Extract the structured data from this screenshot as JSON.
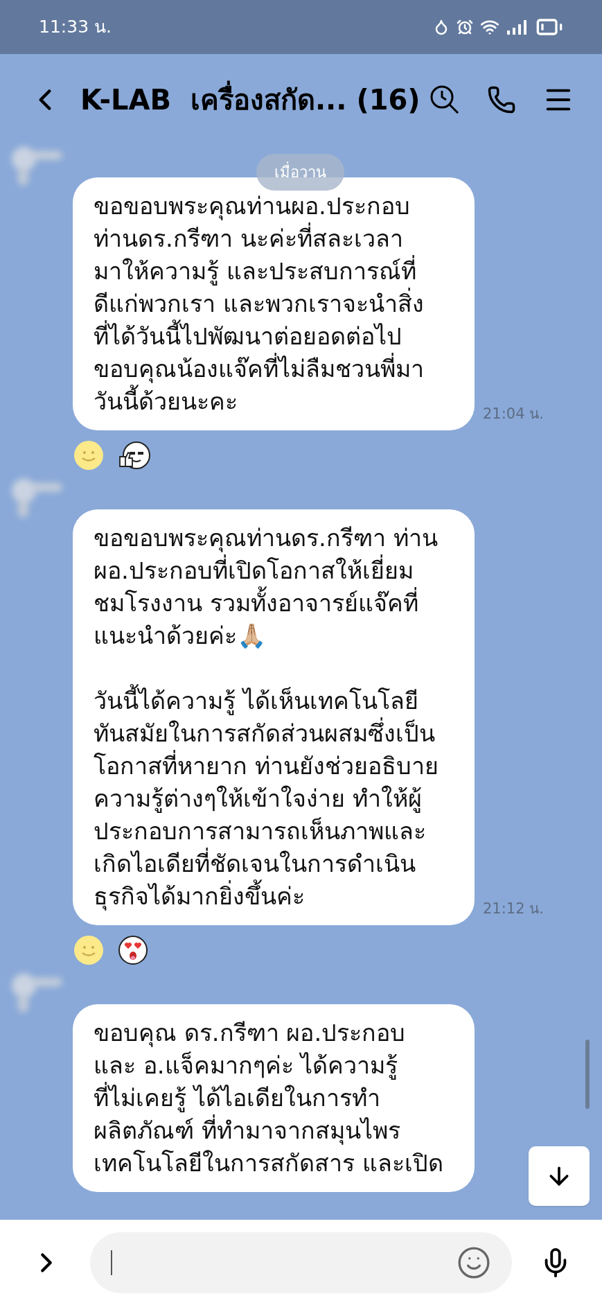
{
  "status_bar": {
    "time": "11:33 น."
  },
  "header": {
    "title": "K-LAB  เครื่องสกัด... (16)"
  },
  "date_chip": "เมื่อวาน",
  "messages": [
    {
      "text": "ขอขอบพระคุณท่านผอ.ประกอบ\nท่านดร.กรีฑา นะค่ะที่สละเวลา\nมาให้ความรู้ และประสบการณ์ที่\nดีแก่พวกเรา และพวกเราจะนำสิ่ง\nที่ได้วันนี้ไปพัฒนาต่อยอดต่อไป\nขอบคุณน้องแจ๊คที่ไม่ลืมชวนพี่มา\nวันนี้ด้วยนะคะ",
      "time": "21:04 น.",
      "reactions": [
        {
          "kind": "smiley"
        },
        {
          "kind": "thumbs-up-face"
        }
      ]
    },
    {
      "text": "ขอขอบพระคุณท่านดร.กรีฑา ท่าน\nผอ.ประกอบที่เปิดโอกาสให้เยี่ยม\nชมโรงงาน รวมทั้งอาจารย์แจ๊คที่\nแนะนำด้วยค่ะ🙏🏼\n\nวันนี้ได้ความรู้ ได้เห็นเทคโนโลยี\nทันสมัยในการสกัดส่วนผสมซึ่งเป็น\nโอกาสที่หายาก ท่านยังช่วยอธิบาย\nความรู้ต่างๆให้เข้าใจง่าย ทำให้ผู้\nประกอบการสามารถเห็นภาพและ\nเกิดไอเดียที่ชัดเจนในการดำเนิน\nธุรกิจได้มากยิ่งขึ้นค่ะ",
      "time": "21:12 น.",
      "reactions": [
        {
          "kind": "smiley"
        },
        {
          "kind": "heart-eyes-face"
        }
      ]
    },
    {
      "text": "ขอบคุณ ดร.กรีฑา ผอ.ประกอบ\nและ อ.แจ็คมากๆค่ะ ได้ความรู้\nที่ไม่เคยรู้ ได้ไอเดียในการทำ\nผลิตภัณฑ์ ที่ทำมาจากสมุนไพร\nเทคโนโลยีในการสกัดสาร และเปิด"
    }
  ]
}
